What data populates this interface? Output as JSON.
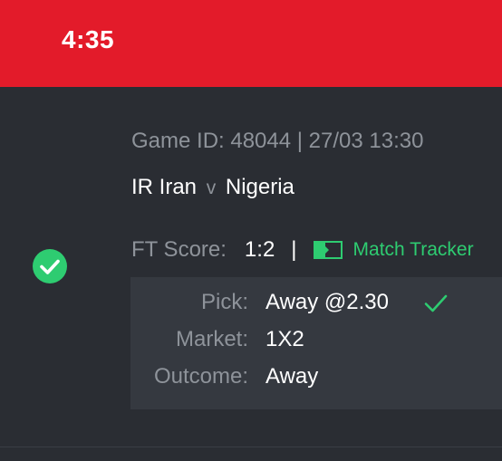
{
  "status_bar": {
    "time": "4:35",
    "background_color": "#e31b2a"
  },
  "ticket": {
    "status_icon": "check-circle-icon",
    "status_color": "#2ecc71",
    "game_id_line": "Game ID: 48044 | 27/03 13:30",
    "home_team": "IR Iran",
    "versus": "v",
    "away_team": "Nigeria",
    "score_label": "FT Score:",
    "score_value": "1:2",
    "separator": "|",
    "tracker_icon": "tracker-field-icon",
    "tracker_label": "Match Tracker",
    "pick_label": "Pick:",
    "pick_value": "Away @2.30",
    "pick_result_icon": "check-icon",
    "market_label": "Market:",
    "market_value": "1X2",
    "outcome_label": "Outcome:",
    "outcome_value": "Away"
  }
}
